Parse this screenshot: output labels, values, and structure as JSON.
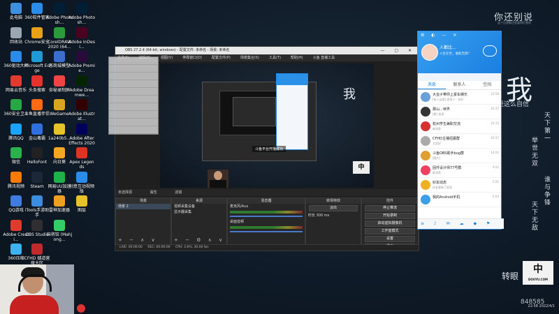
{
  "desktop": {
    "icons": [
      {
        "label": "此电脑",
        "color": "#3d8fe0"
      },
      {
        "label": "回收站",
        "color": "#9aa6b2"
      },
      {
        "label": "360驱动大师",
        "color": "#2a8be8"
      },
      {
        "label": "网易云音乐",
        "color": "#e23a2e"
      },
      {
        "label": "360安全卫士",
        "color": "#28a745"
      },
      {
        "label": "腾讯QQ",
        "color": "#1aa3ff"
      },
      {
        "label": "微信",
        "color": "#2bb24c"
      },
      {
        "label": "腾讯视频",
        "color": "#ff7a00"
      },
      {
        "label": "QQ游戏",
        "color": "#3f7be0"
      },
      {
        "label": "Adobe Creati...",
        "color": "#e03a2e"
      },
      {
        "label": "360压缩",
        "color": "#3cb3f0"
      },
      {
        "label": "360软件管家",
        "color": "#2a8be8"
      },
      {
        "label": "Chrome安全",
        "color": "#e8a117"
      },
      {
        "label": "Microsoft Edge",
        "color": "#1f9ad6"
      },
      {
        "label": "头条搜索",
        "color": "#e5322d"
      },
      {
        "label": "斗鱼直播伴侣",
        "color": "#ff6a13"
      },
      {
        "label": "金山毒霸",
        "color": "#2f6fe0"
      },
      {
        "label": "HelloFont",
        "color": "#222"
      },
      {
        "label": "Steam",
        "color": "#1b2838"
      },
      {
        "label": "iTools手游助手",
        "color": "#3a8de0"
      },
      {
        "label": "OBS Studio",
        "color": "#302e31"
      },
      {
        "label": "CFHD 燧道营 夜大区",
        "color": "#c02a2a"
      },
      {
        "label": "Adobe Photosh...",
        "color": "#001e36"
      },
      {
        "label": "CorelDRAW 2020 (64...",
        "color": "#2a9a3a"
      },
      {
        "label": "客商城模型",
        "color": "#3a6fd0"
      },
      {
        "label": "奈秘录制屏",
        "color": "#e44"
      },
      {
        "label": "WeGame",
        "color": "#d9a521"
      },
      {
        "label": "1a240b5...",
        "color": "#e8c229"
      },
      {
        "label": "向日葵",
        "color": "#f5a623"
      },
      {
        "label": "网易UU加速器",
        "color": "#20b14a"
      },
      {
        "label": "雷神加速器",
        "color": "#f0a020"
      },
      {
        "label": "麻将馆 (Mahjong...",
        "color": "#3c6"
      },
      {
        "label": "Adobe Photosh...",
        "color": "#001e36"
      },
      {
        "label": "Adobe InDesi...",
        "color": "#49021f"
      },
      {
        "label": "Adobe Premie...",
        "color": "#2a0a3a"
      },
      {
        "label": "Adobe Dreamwe...",
        "color": "#072401"
      },
      {
        "label": "Adobe Illustrat...",
        "color": "#330000"
      },
      {
        "label": "Adobe After Effects 2020",
        "color": "#00005b"
      },
      {
        "label": "Apex Legends",
        "color": "#d32"
      },
      {
        "label": "创意互动视频版",
        "color": "#2a8be8"
      },
      {
        "label": "图层",
        "color": "#e8c229"
      }
    ]
  },
  "wallpaper": {
    "top_text": "你还别说",
    "sub_text": "这个比想象还是要得厉害的",
    "big_char": "我",
    "line1": "是这么自信",
    "vertical_cols": [
      "天下第一",
      "举世无双",
      "谁与争锋",
      "天下无敌"
    ],
    "bottom_text": "转眼",
    "number": "848585",
    "logo": "中",
    "logo_sub": "DOUYU.COM"
  },
  "obs": {
    "title": "OBS 27.2.4 (64-bit, windows) - 配置文件: 未命名 - 场景: 未命名",
    "menu": [
      "文件(F)",
      "编辑(E)",
      "视图(V)",
      "停靠窗口(D)",
      "配置文件(P)",
      "场景集合(S)",
      "工具(T)",
      "帮助(H)",
      "斗鱼 直播工具"
    ],
    "preview_label": "斗鱼平台开播成功",
    "scene_bar": [
      "未选择源",
      "属性",
      "滤镜"
    ],
    "docks": {
      "scenes": {
        "title": "场景",
        "items": [
          "场景 2"
        ]
      },
      "sources": {
        "title": "来源",
        "items": [
          "视频采集设备",
          "显示器采集"
        ]
      },
      "mixer": {
        "title": "混音器",
        "channels": [
          "麦克风/Aux",
          "桌面音频"
        ],
        "db": "0.0 dB"
      },
      "transitions": {
        "title": "转场特效",
        "type": "淡出",
        "duration_label": "时长",
        "duration": "300 ms"
      },
      "controls": {
        "title": "控件",
        "buttons": [
          "停止推流",
          "开始录制",
          "启动虚拟摄像机",
          "工作室模式",
          "设置",
          "退出"
        ]
      }
    },
    "status": [
      "LIVE: 00:00:00",
      "REC: 00:00:00",
      "CPU: 3.6%, 30.00 fps"
    ]
  },
  "qq": {
    "nickname": "人都比...",
    "signature": "人生在世，谁能无情？",
    "tabs": [
      "消息",
      "联系人",
      "空间"
    ],
    "rows": [
      {
        "name": "大虫子带你上豪车娱乐",
        "msg": "[有人@我] 浪荡人：你好",
        "time": "22:58",
        "color": "#6aa0d8"
      },
      {
        "name": "那山...世界",
        "msg": "[群] 信息",
        "time": "22:27",
        "color": "#333"
      },
      {
        "name": "杭州学生兼职交流",
        "msg": "新消息",
        "time": "22:13",
        "color": "#d83030"
      },
      {
        "name": "CFHD主播招募群",
        "msg": "大家好",
        "time": "16:37",
        "color": "#aaa"
      },
      {
        "name": "斗鱼OBS助手bug群",
        "msg": "[图片]",
        "time": "14:22",
        "color": "#e0a030"
      },
      {
        "name": "固件设计师77号群",
        "msg": "群消息",
        "time": "9:22",
        "color": "#f04060"
      },
      {
        "name": "好友动态",
        "msg": "好友更新了说说",
        "time": "5:21",
        "color": "#f0b020"
      },
      {
        "name": "我的Android手机",
        "msg": "",
        "time": "5:03",
        "color": "#3a9ee8"
      }
    ]
  },
  "tray": {
    "time": "22:58",
    "date": "2022/4/1"
  }
}
